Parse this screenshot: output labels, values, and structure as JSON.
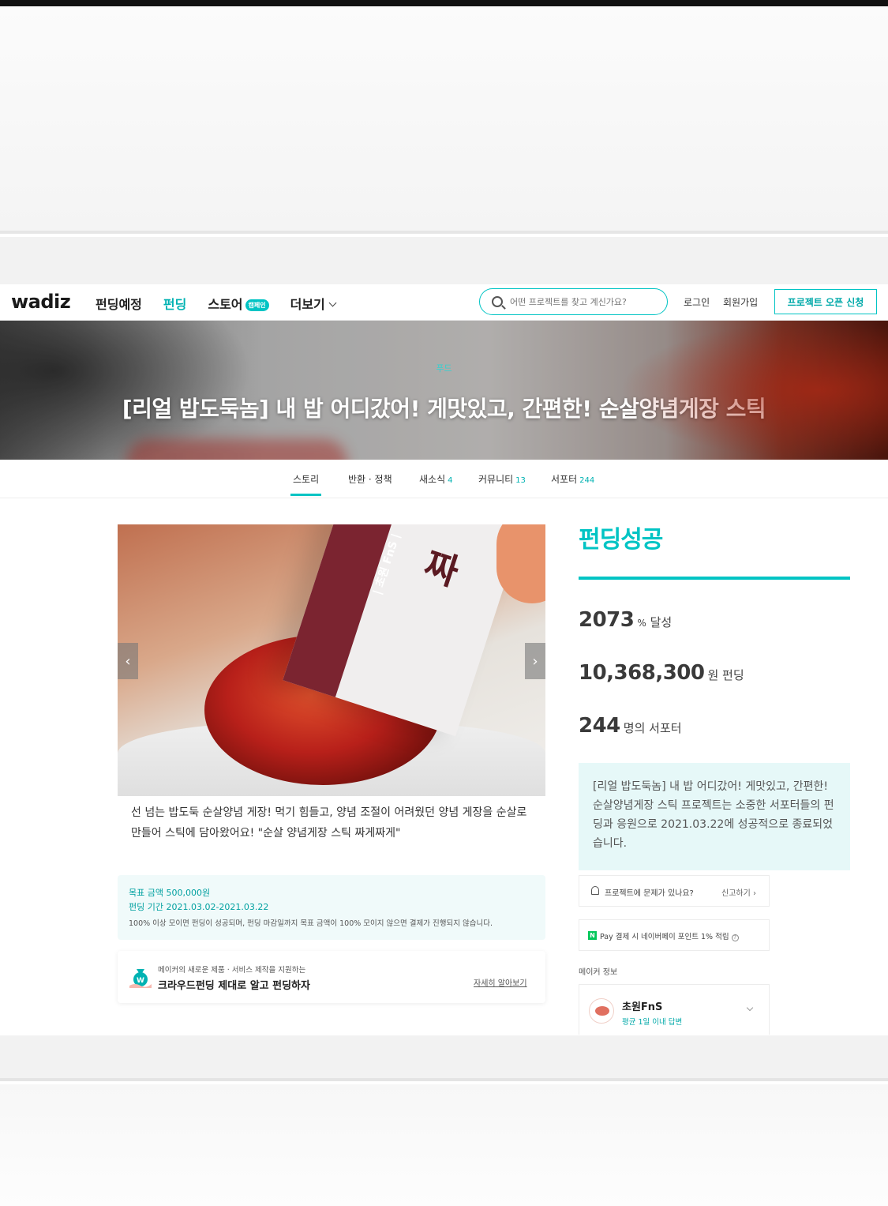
{
  "header": {
    "logo": "wadiz",
    "nav": [
      {
        "label": "펀딩예정"
      },
      {
        "label": "펀딩"
      },
      {
        "label": "스토어",
        "badge": "캠페인"
      },
      {
        "label": "더보기"
      }
    ],
    "search_placeholder": "어떤 프로젝트를 찾고 계신가요?",
    "login": "로그인",
    "signup": "회원가입",
    "open_project": "프로젝트 오픈 신청"
  },
  "hero": {
    "category": "푸드",
    "title": "[리얼 밥도둑놈] 내 밥 어디갔어! 게맛있고, 간편한! 순살양념게장 스틱"
  },
  "tabs": [
    {
      "label": "스토리",
      "count": ""
    },
    {
      "label": "반환 · 정책",
      "count": ""
    },
    {
      "label": "새소식",
      "count": "4"
    },
    {
      "label": "커뮤니티",
      "count": "13"
    },
    {
      "label": "서포터",
      "count": "244"
    }
  ],
  "product": {
    "package_label": "| 초원 FnS |",
    "package_brand": "짜",
    "arrow_left": "‹",
    "arrow_right": "›",
    "summary": "선 넘는 밥도둑 순살양념 게장! 먹기 힘들고, 양념 조절이 어려웠던 양념 게장을 순살로 만들어 스틱에 담아왔어요! \"순살 양념게장 스틱 짜게짜게\""
  },
  "funding_info": {
    "goal_label": "목표 금액",
    "goal_value": "500,000원",
    "period_label": "펀딩 기간",
    "period_value": "2021.03.02-2021.03.22",
    "note": "100% 이상 모이면 펀딩이 성공되며, 펀딩 마감일까지 목표 금액이 100% 모이지 않으면 결제가 진행되지 않습니다."
  },
  "guide": {
    "subtitle": "메이커의 새로운 제품 · 서비스 제작을 지원하는",
    "title": "크라우드펀딩 제대로 알고 펀딩하자",
    "link": "자세히 알아보기"
  },
  "status": {
    "title": "펀딩성공",
    "achieved_num": "2073",
    "achieved_unit": "%",
    "achieved_suffix": "달성",
    "amount_num": "10,368,300",
    "amount_unit": "원 펀딩",
    "supporters_num": "244",
    "supporters_unit": "명의 서포터",
    "message": "[리얼 밥도둑놈] 내 밥 어디갔어! 게맛있고, 간편한! 순살양념게장 스틱 프로젝트는 소중한 서포터들의 펀딩과 응원으로 2021.03.22에 성공적으로 종료되었습니다."
  },
  "report": {
    "text": "프로젝트에 문제가 있나요?",
    "link": "신고하기 ›"
  },
  "npay": {
    "icon": "N",
    "text": "Pay 결제 시 네이버페이 포인트 1% 적립"
  },
  "maker": {
    "label": "메이커 정보",
    "name": "초원FnS",
    "reply": "평균 1일 이내 답변"
  },
  "colors": {
    "accent": "#00c4c4",
    "naver": "#03c75a"
  }
}
